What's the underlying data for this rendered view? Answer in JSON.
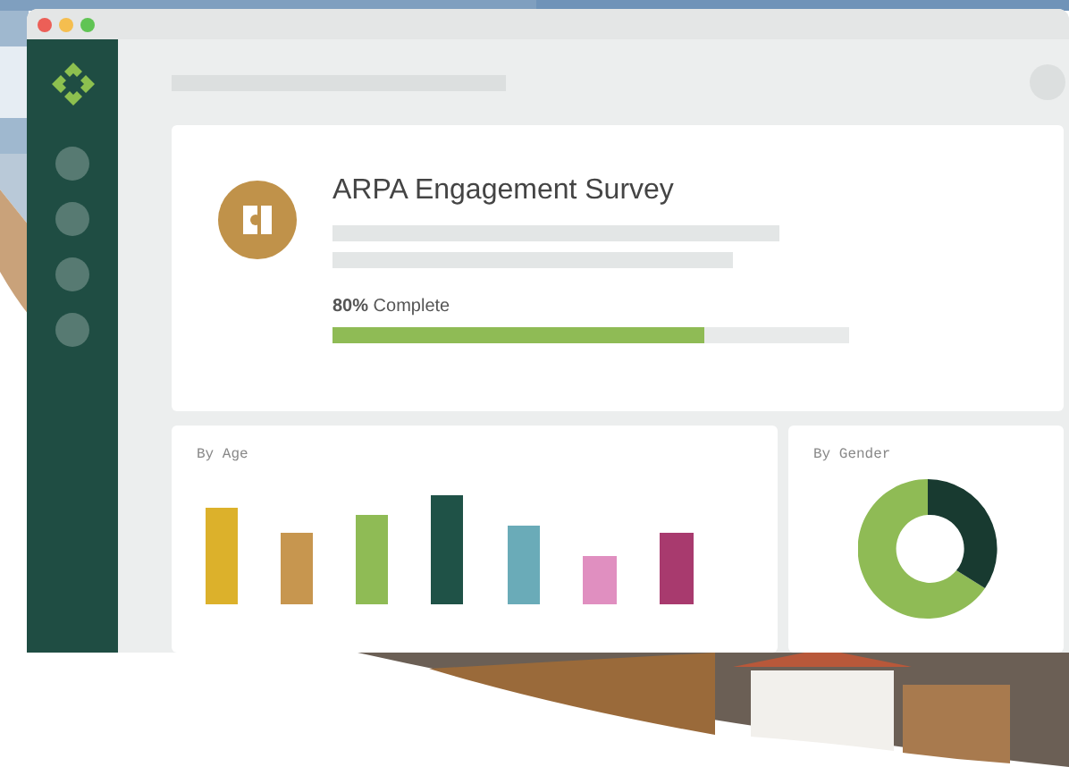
{
  "survey": {
    "title": "ARPA Engagement Survey",
    "progress_label": "**80%** Complete",
    "level": 0.72
  },
  "panels": [
    {
      "title": "By Age",
      "kind": "bar"
    },
    {
      "title": "By Gender",
      "kind": "donut"
    }
  ]
}
